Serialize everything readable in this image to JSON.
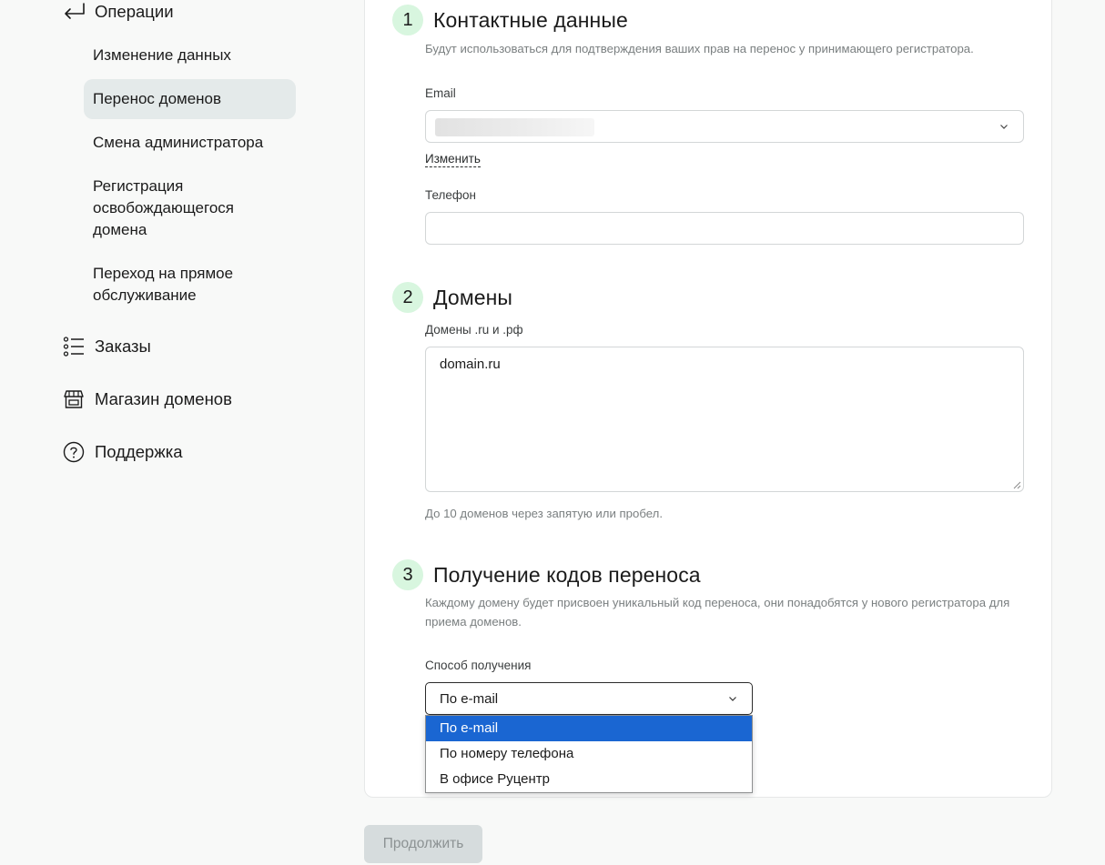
{
  "sidebar": {
    "back": {
      "label": "Операции",
      "icon": "back-arrow-icon"
    },
    "sub_items": [
      {
        "label": "Изменение данных"
      },
      {
        "label": "Перенос доменов"
      },
      {
        "label": "Смена администратора"
      },
      {
        "label": "Регистрация освобождающегося домена"
      },
      {
        "label": "Переход на прямое обслуживание"
      }
    ],
    "main_items": [
      {
        "label": "Заказы",
        "icon": "list-icon"
      },
      {
        "label": "Магазин доменов",
        "icon": "store-icon"
      },
      {
        "label": "Поддержка",
        "icon": "question-circle-icon"
      }
    ]
  },
  "form": {
    "section1": {
      "number": "1",
      "title": "Контактные данные",
      "hint": "Будут использоваться для подтверждения ваших прав на перенос у принимающего регистратора.",
      "email_label": "Email",
      "change_link": "Изменить",
      "phone_label": "Телефон"
    },
    "section2": {
      "number": "2",
      "title": "Домены",
      "domains_label": "Домены .ru и .рф",
      "domains_value": "domain.ru",
      "domains_hint": "До 10 доменов через запятую или пробел."
    },
    "section3": {
      "number": "3",
      "title": "Получение кодов переноса",
      "hint": "Каждому домену будет присвоен уникальный код переноса, они понадобятся у нового регистратора для приема доменов.",
      "method_label": "Способ получения",
      "method_value": "По e-mail",
      "options": [
        "По e-mail",
        "По номеру телефона",
        "В офисе Руцентр"
      ]
    },
    "continue_label": "Продолжить"
  },
  "colors": {
    "accent_green": "#d8f6df",
    "active_nav": "#e4eaea",
    "selected_option": "#1a66d2",
    "button_disabled": "#d6dcdd"
  }
}
